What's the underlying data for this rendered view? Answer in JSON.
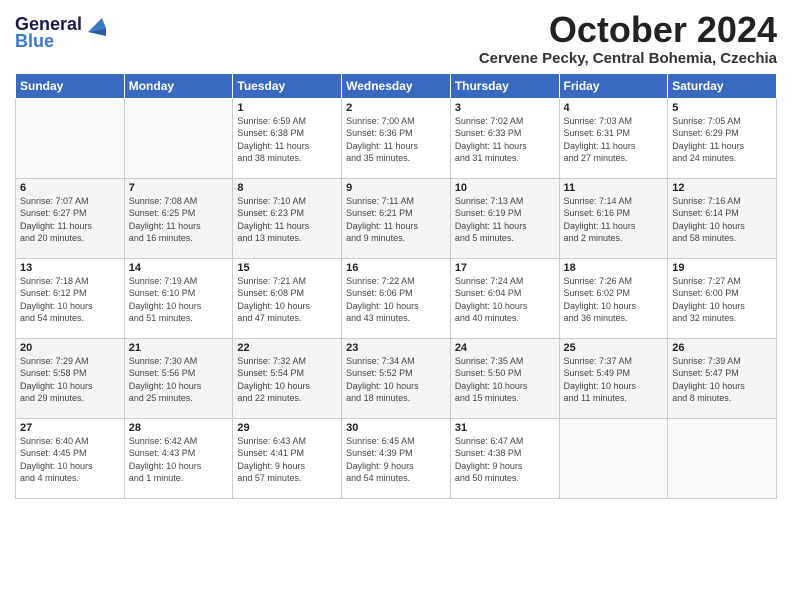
{
  "logo": {
    "line1": "General",
    "line2": "Blue"
  },
  "title": "October 2024",
  "subtitle": "Cervene Pecky, Central Bohemia, Czechia",
  "days_header": [
    "Sunday",
    "Monday",
    "Tuesday",
    "Wednesday",
    "Thursday",
    "Friday",
    "Saturday"
  ],
  "weeks": [
    [
      {
        "day": "",
        "info": ""
      },
      {
        "day": "",
        "info": ""
      },
      {
        "day": "1",
        "info": "Sunrise: 6:59 AM\nSunset: 6:38 PM\nDaylight: 11 hours\nand 38 minutes."
      },
      {
        "day": "2",
        "info": "Sunrise: 7:00 AM\nSunset: 6:36 PM\nDaylight: 11 hours\nand 35 minutes."
      },
      {
        "day": "3",
        "info": "Sunrise: 7:02 AM\nSunset: 6:33 PM\nDaylight: 11 hours\nand 31 minutes."
      },
      {
        "day": "4",
        "info": "Sunrise: 7:03 AM\nSunset: 6:31 PM\nDaylight: 11 hours\nand 27 minutes."
      },
      {
        "day": "5",
        "info": "Sunrise: 7:05 AM\nSunset: 6:29 PM\nDaylight: 11 hours\nand 24 minutes."
      }
    ],
    [
      {
        "day": "6",
        "info": "Sunrise: 7:07 AM\nSunset: 6:27 PM\nDaylight: 11 hours\nand 20 minutes."
      },
      {
        "day": "7",
        "info": "Sunrise: 7:08 AM\nSunset: 6:25 PM\nDaylight: 11 hours\nand 16 minutes."
      },
      {
        "day": "8",
        "info": "Sunrise: 7:10 AM\nSunset: 6:23 PM\nDaylight: 11 hours\nand 13 minutes."
      },
      {
        "day": "9",
        "info": "Sunrise: 7:11 AM\nSunset: 6:21 PM\nDaylight: 11 hours\nand 9 minutes."
      },
      {
        "day": "10",
        "info": "Sunrise: 7:13 AM\nSunset: 6:19 PM\nDaylight: 11 hours\nand 5 minutes."
      },
      {
        "day": "11",
        "info": "Sunrise: 7:14 AM\nSunset: 6:16 PM\nDaylight: 11 hours\nand 2 minutes."
      },
      {
        "day": "12",
        "info": "Sunrise: 7:16 AM\nSunset: 6:14 PM\nDaylight: 10 hours\nand 58 minutes."
      }
    ],
    [
      {
        "day": "13",
        "info": "Sunrise: 7:18 AM\nSunset: 6:12 PM\nDaylight: 10 hours\nand 54 minutes."
      },
      {
        "day": "14",
        "info": "Sunrise: 7:19 AM\nSunset: 6:10 PM\nDaylight: 10 hours\nand 51 minutes."
      },
      {
        "day": "15",
        "info": "Sunrise: 7:21 AM\nSunset: 6:08 PM\nDaylight: 10 hours\nand 47 minutes."
      },
      {
        "day": "16",
        "info": "Sunrise: 7:22 AM\nSunset: 6:06 PM\nDaylight: 10 hours\nand 43 minutes."
      },
      {
        "day": "17",
        "info": "Sunrise: 7:24 AM\nSunset: 6:04 PM\nDaylight: 10 hours\nand 40 minutes."
      },
      {
        "day": "18",
        "info": "Sunrise: 7:26 AM\nSunset: 6:02 PM\nDaylight: 10 hours\nand 36 minutes."
      },
      {
        "day": "19",
        "info": "Sunrise: 7:27 AM\nSunset: 6:00 PM\nDaylight: 10 hours\nand 32 minutes."
      }
    ],
    [
      {
        "day": "20",
        "info": "Sunrise: 7:29 AM\nSunset: 5:58 PM\nDaylight: 10 hours\nand 29 minutes."
      },
      {
        "day": "21",
        "info": "Sunrise: 7:30 AM\nSunset: 5:56 PM\nDaylight: 10 hours\nand 25 minutes."
      },
      {
        "day": "22",
        "info": "Sunrise: 7:32 AM\nSunset: 5:54 PM\nDaylight: 10 hours\nand 22 minutes."
      },
      {
        "day": "23",
        "info": "Sunrise: 7:34 AM\nSunset: 5:52 PM\nDaylight: 10 hours\nand 18 minutes."
      },
      {
        "day": "24",
        "info": "Sunrise: 7:35 AM\nSunset: 5:50 PM\nDaylight: 10 hours\nand 15 minutes."
      },
      {
        "day": "25",
        "info": "Sunrise: 7:37 AM\nSunset: 5:49 PM\nDaylight: 10 hours\nand 11 minutes."
      },
      {
        "day": "26",
        "info": "Sunrise: 7:39 AM\nSunset: 5:47 PM\nDaylight: 10 hours\nand 8 minutes."
      }
    ],
    [
      {
        "day": "27",
        "info": "Sunrise: 6:40 AM\nSunset: 4:45 PM\nDaylight: 10 hours\nand 4 minutes."
      },
      {
        "day": "28",
        "info": "Sunrise: 6:42 AM\nSunset: 4:43 PM\nDaylight: 10 hours\nand 1 minute."
      },
      {
        "day": "29",
        "info": "Sunrise: 6:43 AM\nSunset: 4:41 PM\nDaylight: 9 hours\nand 57 minutes."
      },
      {
        "day": "30",
        "info": "Sunrise: 6:45 AM\nSunset: 4:39 PM\nDaylight: 9 hours\nand 54 minutes."
      },
      {
        "day": "31",
        "info": "Sunrise: 6:47 AM\nSunset: 4:38 PM\nDaylight: 9 hours\nand 50 minutes."
      },
      {
        "day": "",
        "info": ""
      },
      {
        "day": "",
        "info": ""
      }
    ]
  ]
}
